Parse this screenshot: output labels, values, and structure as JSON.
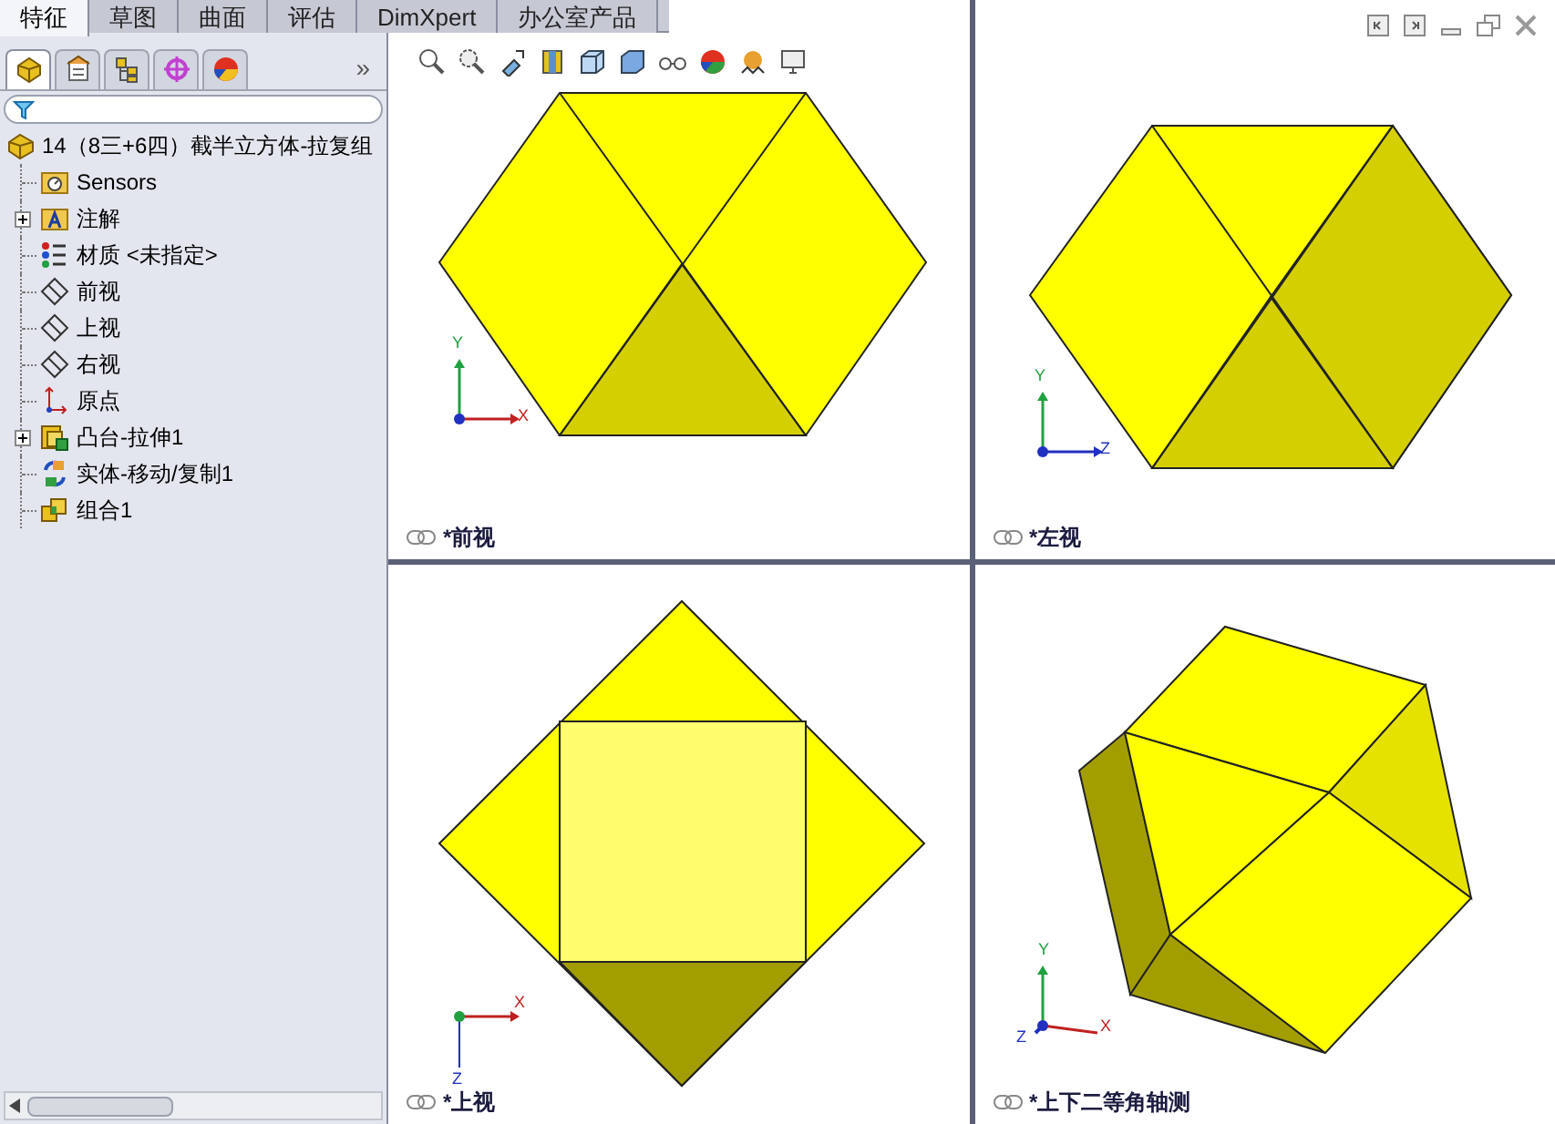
{
  "tabs": [
    {
      "label": "特征",
      "selected": true
    },
    {
      "label": "草图",
      "selected": false
    },
    {
      "label": "曲面",
      "selected": false
    },
    {
      "label": "评估",
      "selected": false
    },
    {
      "label": "DimXpert",
      "selected": false
    },
    {
      "label": "办公室产品",
      "selected": false
    }
  ],
  "panel_tabs": [
    {
      "kind": "feature",
      "selected": true
    },
    {
      "kind": "property",
      "selected": false
    },
    {
      "kind": "config",
      "selected": false
    },
    {
      "kind": "dimxpert",
      "selected": false
    },
    {
      "kind": "display",
      "selected": false
    }
  ],
  "panel_more": "»",
  "tree": {
    "label": "14（8三+6四）截半立方体-拉复组",
    "children": [
      {
        "kind": "sensor",
        "label": "Sensors",
        "expandable": false
      },
      {
        "kind": "annotation",
        "label": "注解",
        "expandable": true
      },
      {
        "kind": "material",
        "label": "材质 <未指定>",
        "expandable": false
      },
      {
        "kind": "plane",
        "label": "前视",
        "expandable": false
      },
      {
        "kind": "plane",
        "label": "上视",
        "expandable": false
      },
      {
        "kind": "plane",
        "label": "右视",
        "expandable": false
      },
      {
        "kind": "origin",
        "label": "原点",
        "expandable": false
      },
      {
        "kind": "boss",
        "label": "凸台-拉伸1",
        "expandable": true
      },
      {
        "kind": "move",
        "label": "实体-移动/复制1",
        "expandable": false
      },
      {
        "kind": "combine",
        "label": "组合1",
        "expandable": false
      }
    ]
  },
  "viewports": [
    {
      "kind": "front",
      "label": "*前视",
      "axes": [
        "Y",
        "X"
      ]
    },
    {
      "kind": "left",
      "label": "*左视",
      "axes": [
        "Y",
        "Z"
      ]
    },
    {
      "kind": "top",
      "label": "*上视",
      "axes": [
        "X",
        "Z"
      ]
    },
    {
      "kind": "iso",
      "label": "*上下二等角轴测",
      "axes": [
        "Y",
        "X",
        "Z"
      ]
    }
  ]
}
